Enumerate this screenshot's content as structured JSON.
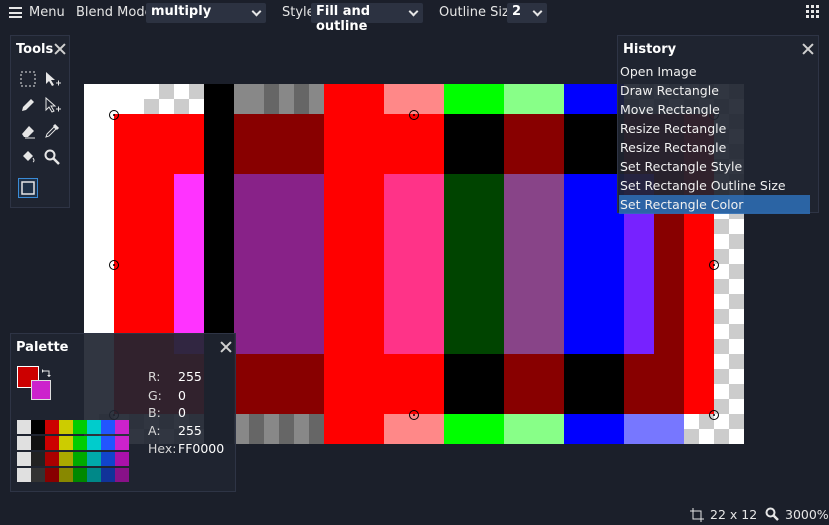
{
  "toolbar": {
    "menu_label": "Menu",
    "blend_mode_label": "Blend Mode:",
    "blend_mode_value": "multiply",
    "style_label": "Style:",
    "style_value": "Fill and outline",
    "outline_size_label": "Outline Size:",
    "outline_size_value": "2",
    "icons": [
      "menu-icon",
      "grid-toggle-icon"
    ]
  },
  "tools_panel": {
    "title": "Tools",
    "tools": [
      {
        "name": "rectangle-select-icon",
        "glyph": "⬚"
      },
      {
        "name": "move-selection-icon",
        "glyph": "➤"
      },
      {
        "name": "pencil-icon",
        "glyph": "✎"
      },
      {
        "name": "move-pixels-icon",
        "glyph": "➤"
      },
      {
        "name": "eraser-icon",
        "glyph": "⌫"
      },
      {
        "name": "eyedropper-icon",
        "glyph": "⚲"
      },
      {
        "name": "fill-bucket-icon",
        "glyph": "⛁"
      },
      {
        "name": "zoom-icon",
        "glyph": "⚲"
      },
      {
        "name": "rectangle-tool-icon",
        "glyph": "□"
      }
    ]
  },
  "history_panel": {
    "title": "History",
    "items": [
      "Open Image",
      "Draw Rectangle",
      "Move Rectangle",
      "Resize Rectangle",
      "Resize Rectangle",
      "Set Rectangle Style",
      "Set Rectangle Outline Size",
      "Set Rectangle Color"
    ],
    "selected_index": 7
  },
  "palette_panel": {
    "title": "Palette",
    "primary_color": "#cc0000",
    "secondary_color": "#cc22cc",
    "channels": [
      {
        "label": "R:",
        "value": "255"
      },
      {
        "label": "G:",
        "value": "0"
      },
      {
        "label": "B:",
        "value": "0"
      },
      {
        "label": "A:",
        "value": "255"
      }
    ],
    "hex_label": "Hex:",
    "hex_value": "FF0000",
    "swatch_rows": [
      [
        "#e0e0e0",
        "#000000",
        "#cc0000",
        "#cccc00",
        "#00cc00",
        "#00cccc",
        "#2255ff",
        "#cc22cc"
      ],
      [
        "#e0e0e0",
        "#111111",
        "#cc0000",
        "#cccc00",
        "#00cc00",
        "#00cccc",
        "#2255ff",
        "#cc22cc"
      ],
      [
        "#e0e0e0",
        "#222222",
        "#aa0000",
        "#aaaa00",
        "#00aa00",
        "#00aaaa",
        "#1144cc",
        "#aa11aa"
      ],
      [
        "#e0e0e0",
        "#333333",
        "#880000",
        "#888800",
        "#008800",
        "#008888",
        "#113399",
        "#881188"
      ]
    ]
  },
  "status_bar": {
    "canvas_size": "22 x 12",
    "zoom": "3000%",
    "icons": [
      "canvas-size-icon",
      "zoom-level-icon"
    ]
  },
  "colors": {
    "accent": "#3a8bd6",
    "selection": "#2e6db4",
    "background": "#1b1f2a",
    "panel": "#202531"
  }
}
